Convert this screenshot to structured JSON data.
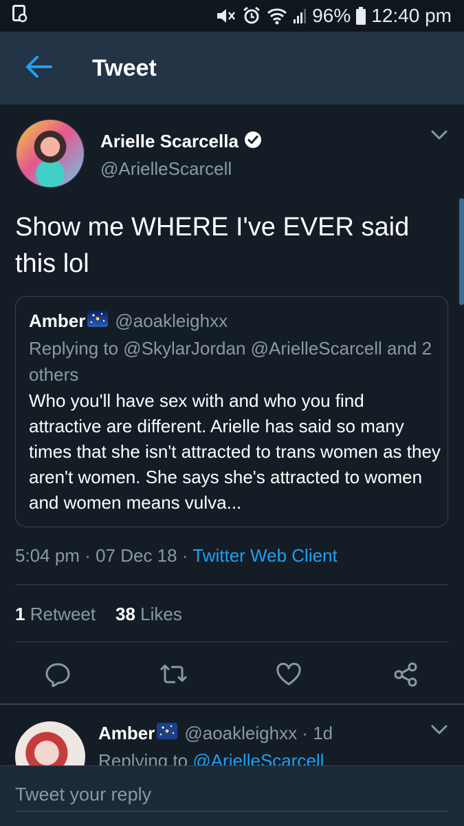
{
  "status_bar": {
    "battery": "96%",
    "time": "12:40 pm",
    "icons": [
      "notification-icon",
      "mute-icon",
      "alarm-icon",
      "wifi-icon",
      "signal-icon",
      "battery-icon"
    ]
  },
  "header": {
    "title": "Tweet",
    "back_icon": "back-arrow-icon"
  },
  "tweet": {
    "author_name": "Arielle Scarcella",
    "author_handle": "@ArielleScarcell",
    "verified": true,
    "text": "Show me WHERE I've EVER said this lol",
    "quote": {
      "name": "Amber",
      "handle": "@aoakleighxx",
      "replying": "Replying to @SkylarJordan @ArielleScarcell and 2 others",
      "text": "Who you'll have sex with and who you find attractive are different. Arielle has said so many times that she isn't attracted to trans women as they aren't women. She says she's attracted to women and women means vulva..."
    },
    "time": "5:04 pm",
    "date": "07 Dec 18",
    "client": "Twitter Web Client",
    "retweet_count": "1",
    "retweet_label": "Retweet",
    "like_count": "38",
    "like_label": "Likes"
  },
  "reply": {
    "name": "Amber",
    "handle": "@aoakleighxx",
    "age": "1d",
    "replying_prefix": "Replying to",
    "replying_mention": "@ArielleScarcell"
  },
  "compose": {
    "placeholder": "Tweet your reply"
  },
  "colors": {
    "background": "#141d26",
    "header": "#243447",
    "accent": "#1da1f2",
    "secondary_text": "#8899a6",
    "divider": "#38444d"
  }
}
